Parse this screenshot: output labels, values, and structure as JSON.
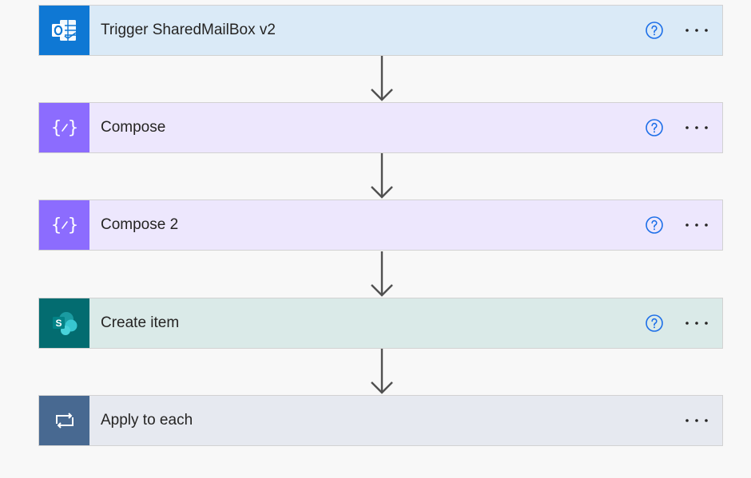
{
  "colors": {
    "outlook_header": "#daeaf7",
    "outlook_icon_bg": "#0f78d4",
    "compose_header": "#ede7fd",
    "compose_icon_bg": "#8c6cfe",
    "sharepoint_header": "#daeae8",
    "sharepoint_icon_bg": "#036c70",
    "apply_header": "#e6e9f0",
    "apply_icon_bg": "#486991",
    "help_icon": "#1d6fe8",
    "arrow": "#505050"
  },
  "steps": [
    {
      "title": "Trigger SharedMailBox v2",
      "icon": "outlook-icon",
      "has_help": true
    },
    {
      "title": "Compose",
      "icon": "compose-icon",
      "has_help": true
    },
    {
      "title": "Compose 2",
      "icon": "compose-icon",
      "has_help": true
    },
    {
      "title": "Create item",
      "icon": "sharepoint-icon",
      "has_help": true
    },
    {
      "title": "Apply to each",
      "icon": "loop-icon",
      "has_help": false
    }
  ]
}
